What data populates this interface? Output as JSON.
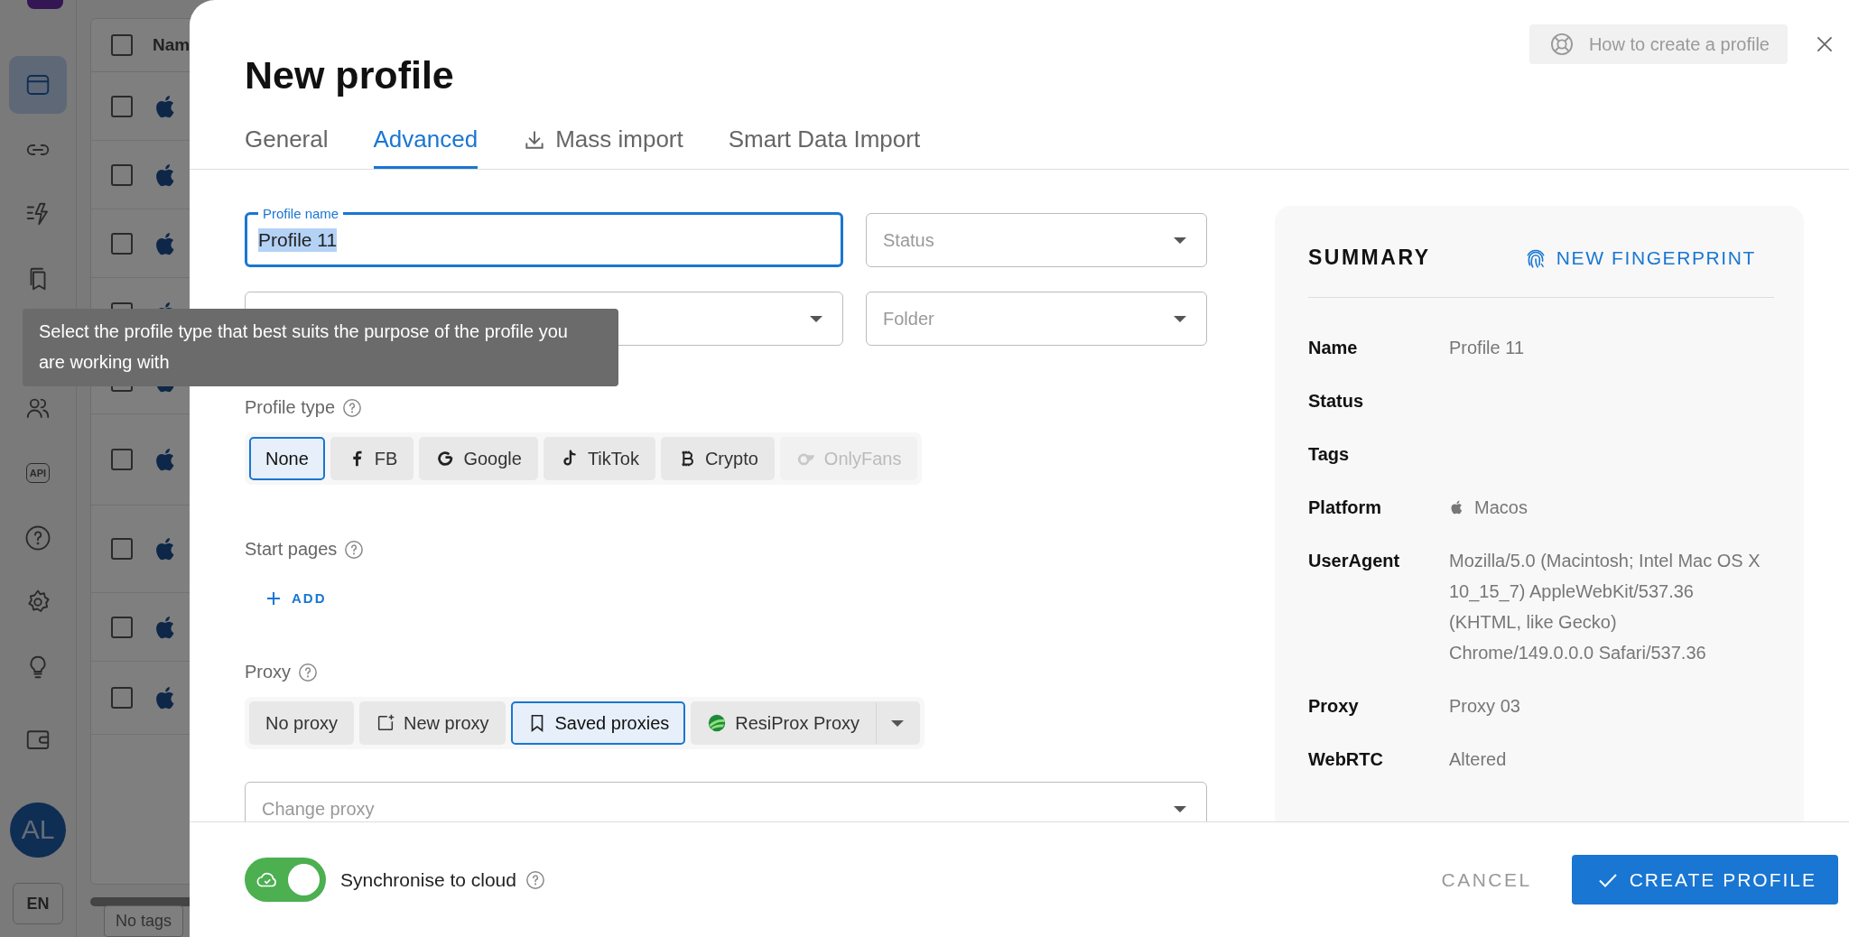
{
  "sidebar": {
    "items": [
      {
        "selected": true
      },
      {
        "selected": false
      },
      {
        "selected": false
      },
      {
        "selected": false
      },
      {
        "selected": false
      },
      {
        "selected": false,
        "label": "API"
      },
      {
        "selected": false
      },
      {
        "selected": false
      },
      {
        "selected": false
      },
      {
        "selected": false
      }
    ],
    "avatar": "AL",
    "language": "EN"
  },
  "table": {
    "header": "Nam",
    "all_checked": false,
    "rows": [
      {
        "checked": false
      },
      {
        "checked": false
      },
      {
        "checked": false
      },
      {
        "checked": false
      },
      {
        "checked": false
      },
      {
        "checked": false
      },
      {
        "checked": false
      },
      {
        "checked": false
      },
      {
        "checked": false
      }
    ],
    "tag_filter": "No tags"
  },
  "dialog": {
    "title": "New profile",
    "help_button": "How to create a profile",
    "tabs": [
      {
        "label": "General",
        "selected": false,
        "kind": "plain"
      },
      {
        "label": "Advanced",
        "selected": true,
        "kind": "plain"
      },
      {
        "label": "Mass import",
        "selected": false,
        "kind": "import"
      },
      {
        "label": "Smart Data Import",
        "selected": false,
        "kind": "plain"
      }
    ],
    "profile_name": {
      "label": "Profile name",
      "value": "Profile 11",
      "focused": true
    },
    "status": {
      "placeholder": "Status"
    },
    "folder": {
      "placeholder": "Folder"
    },
    "profile_type": {
      "label": "Profile type",
      "options": [
        {
          "label": "None",
          "selected": true,
          "disabled": false
        },
        {
          "label": "FB",
          "selected": false,
          "disabled": false
        },
        {
          "label": "Google",
          "selected": false,
          "disabled": false
        },
        {
          "label": "TikTok",
          "selected": false,
          "disabled": false
        },
        {
          "label": "Crypto",
          "selected": false,
          "disabled": false
        },
        {
          "label": "OnlyFans",
          "selected": false,
          "disabled": true
        }
      ]
    },
    "start_pages": {
      "label": "Start pages",
      "add_button": "ADD"
    },
    "proxy": {
      "label": "Proxy",
      "options": [
        {
          "label": "No proxy",
          "selected": false
        },
        {
          "label": "New proxy",
          "selected": false
        },
        {
          "label": "Saved proxies",
          "selected": true
        },
        {
          "label": "ResiProx Proxy",
          "selected": false
        }
      ],
      "change_placeholder": "Change proxy"
    },
    "summary": {
      "title": "SUMMARY",
      "fingerprint_button": "NEW FINGERPRINT",
      "rows": [
        {
          "label": "Name",
          "value": "Profile 11",
          "kind": "text"
        },
        {
          "label": "Status",
          "kind": "text"
        },
        {
          "label": "Tags",
          "kind": "text"
        },
        {
          "label": "Platform",
          "value": "Macos",
          "kind": "platform"
        },
        {
          "label": "UserAgent",
          "value": "Mozilla/5.0 (Macintosh; Intel Mac OS X 10_15_7) AppleWebKit/537.36 (KHTML, like Gecko) Chrome/149.0.0.0 Safari/537.36",
          "kind": "text"
        },
        {
          "label": "Proxy",
          "value": "Proxy 03",
          "kind": "text"
        },
        {
          "label": "WebRTC",
          "value": "Altered",
          "kind": "text"
        }
      ]
    },
    "sync": {
      "label": "Synchronise to cloud",
      "on": true
    },
    "cancel_button": "CANCEL",
    "create_button": "CREATE PROFILE"
  },
  "tooltip": {
    "text": "Select the profile type that best suits the purpose of the profile you are working with"
  }
}
